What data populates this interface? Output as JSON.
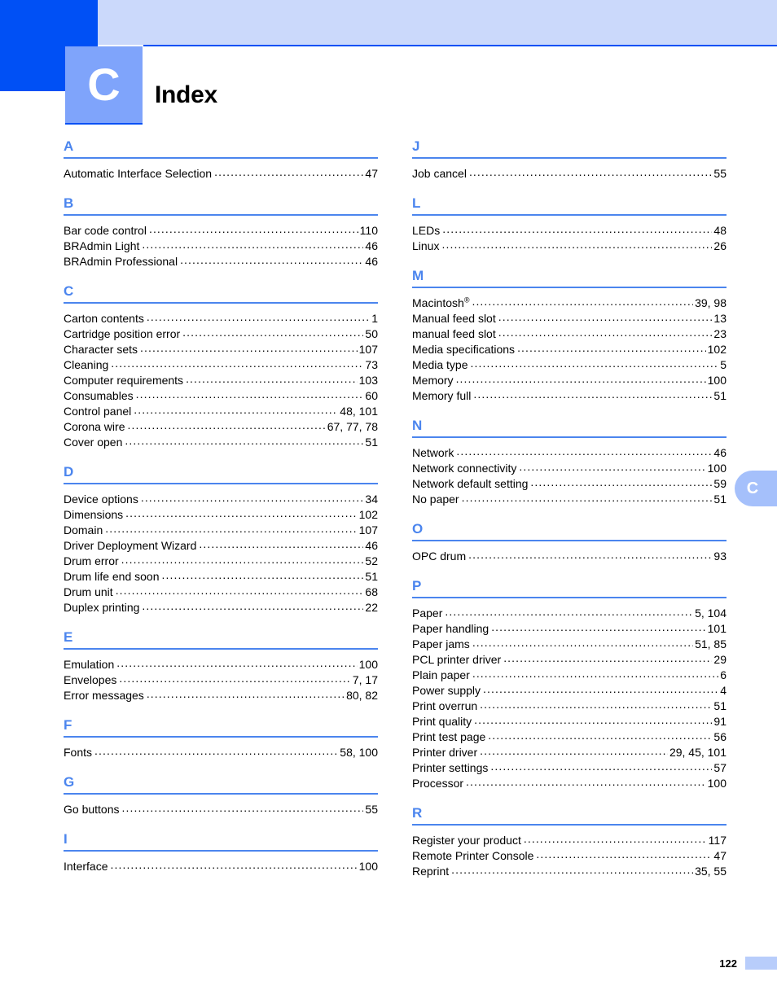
{
  "header": {
    "chapter_letter": "C",
    "title": "Index",
    "dark_block_color": "#0050f5",
    "light_bar_color": "#cbd9fb",
    "chapter_box_color": "#7fa4fb"
  },
  "side_tab": {
    "letter": "C",
    "color": "#a5c0fb"
  },
  "footer": {
    "page_number": "122",
    "block_color": "#b8cdfb"
  },
  "theme": {
    "section_letter_color": "#4b85ee",
    "rule_color": "#4b85ee",
    "text_color": "#000000"
  },
  "columns": [
    {
      "name": "left",
      "sections": [
        {
          "letter": "A",
          "entries": [
            {
              "term": "Automatic Interface Selection",
              "page": "47"
            }
          ]
        },
        {
          "letter": "B",
          "entries": [
            {
              "term": "Bar code control",
              "page": "110"
            },
            {
              "term": "BRAdmin Light",
              "page": "46"
            },
            {
              "term": "BRAdmin Professional",
              "page": "46"
            }
          ]
        },
        {
          "letter": "C",
          "entries": [
            {
              "term": "Carton contents",
              "page": "1"
            },
            {
              "term": "Cartridge position error",
              "page": "50"
            },
            {
              "term": "Character sets",
              "page": "107"
            },
            {
              "term": "Cleaning",
              "page": "73"
            },
            {
              "term": "Computer requirements",
              "page": "103"
            },
            {
              "term": "Consumables",
              "page": "60"
            },
            {
              "term": "Control panel",
              "page": "48, 101"
            },
            {
              "term": "Corona wire",
              "page": "67, 77, 78"
            },
            {
              "term": "Cover open",
              "page": "51"
            }
          ]
        },
        {
          "letter": "D",
          "entries": [
            {
              "term": "Device options",
              "page": "34"
            },
            {
              "term": "Dimensions",
              "page": "102"
            },
            {
              "term": "Domain",
              "page": "107"
            },
            {
              "term": "Driver Deployment Wizard",
              "page": "46"
            },
            {
              "term": "Drum error",
              "page": "52"
            },
            {
              "term": "Drum life end soon",
              "page": "51"
            },
            {
              "term": "Drum unit",
              "page": "68"
            },
            {
              "term": "Duplex printing",
              "page": "22"
            }
          ]
        },
        {
          "letter": "E",
          "entries": [
            {
              "term": "Emulation",
              "page": "100"
            },
            {
              "term": "Envelopes",
              "page": "7, 17"
            },
            {
              "term": "Error messages",
              "page": "80, 82"
            }
          ]
        },
        {
          "letter": "F",
          "entries": [
            {
              "term": "Fonts",
              "page": "58, 100"
            }
          ]
        },
        {
          "letter": "G",
          "entries": [
            {
              "term": "Go buttons",
              "page": "55"
            }
          ]
        },
        {
          "letter": "I",
          "entries": [
            {
              "term": "Interface",
              "page": "100"
            }
          ]
        }
      ]
    },
    {
      "name": "right",
      "sections": [
        {
          "letter": "J",
          "entries": [
            {
              "term": "Job cancel",
              "page": "55"
            }
          ]
        },
        {
          "letter": "L",
          "entries": [
            {
              "term": "LEDs",
              "page": "48"
            },
            {
              "term": "Linux",
              "page": "26"
            }
          ]
        },
        {
          "letter": "M",
          "entries": [
            {
              "term": "Macintosh",
              "superscript": "®",
              "page": "39, 98"
            },
            {
              "term": "Manual feed slot",
              "page": "13"
            },
            {
              "term": "manual feed slot",
              "page": "23"
            },
            {
              "term": "Media specifications",
              "page": "102"
            },
            {
              "term": "Media type",
              "page": "5"
            },
            {
              "term": "Memory",
              "page": "100"
            },
            {
              "term": "Memory full",
              "page": "51"
            }
          ]
        },
        {
          "letter": "N",
          "entries": [
            {
              "term": "Network",
              "page": "46"
            },
            {
              "term": "Network connectivity",
              "page": "100"
            },
            {
              "term": "Network default setting",
              "page": "59"
            },
            {
              "term": "No paper",
              "page": "51"
            }
          ]
        },
        {
          "letter": "O",
          "entries": [
            {
              "term": "OPC drum",
              "page": "93"
            }
          ]
        },
        {
          "letter": "P",
          "entries": [
            {
              "term": "Paper",
              "page": "5, 104"
            },
            {
              "term": "Paper handling",
              "page": "101"
            },
            {
              "term": "Paper jams",
              "page": "51, 85"
            },
            {
              "term": "PCL printer driver",
              "page": "29"
            },
            {
              "term": "Plain paper",
              "page": "6"
            },
            {
              "term": "Power supply",
              "page": "4"
            },
            {
              "term": "Print overrun",
              "page": "51"
            },
            {
              "term": "Print quality",
              "page": "91"
            },
            {
              "term": "Print test page",
              "page": "56"
            },
            {
              "term": "Printer driver",
              "page": "29, 45, 101"
            },
            {
              "term": "Printer settings",
              "page": "57"
            },
            {
              "term": "Processor",
              "page": "100"
            }
          ]
        },
        {
          "letter": "R",
          "entries": [
            {
              "term": "Register your product",
              "page": "117"
            },
            {
              "term": "Remote Printer Console",
              "page": "47"
            },
            {
              "term": "Reprint",
              "page": "35, 55"
            }
          ]
        }
      ]
    }
  ]
}
